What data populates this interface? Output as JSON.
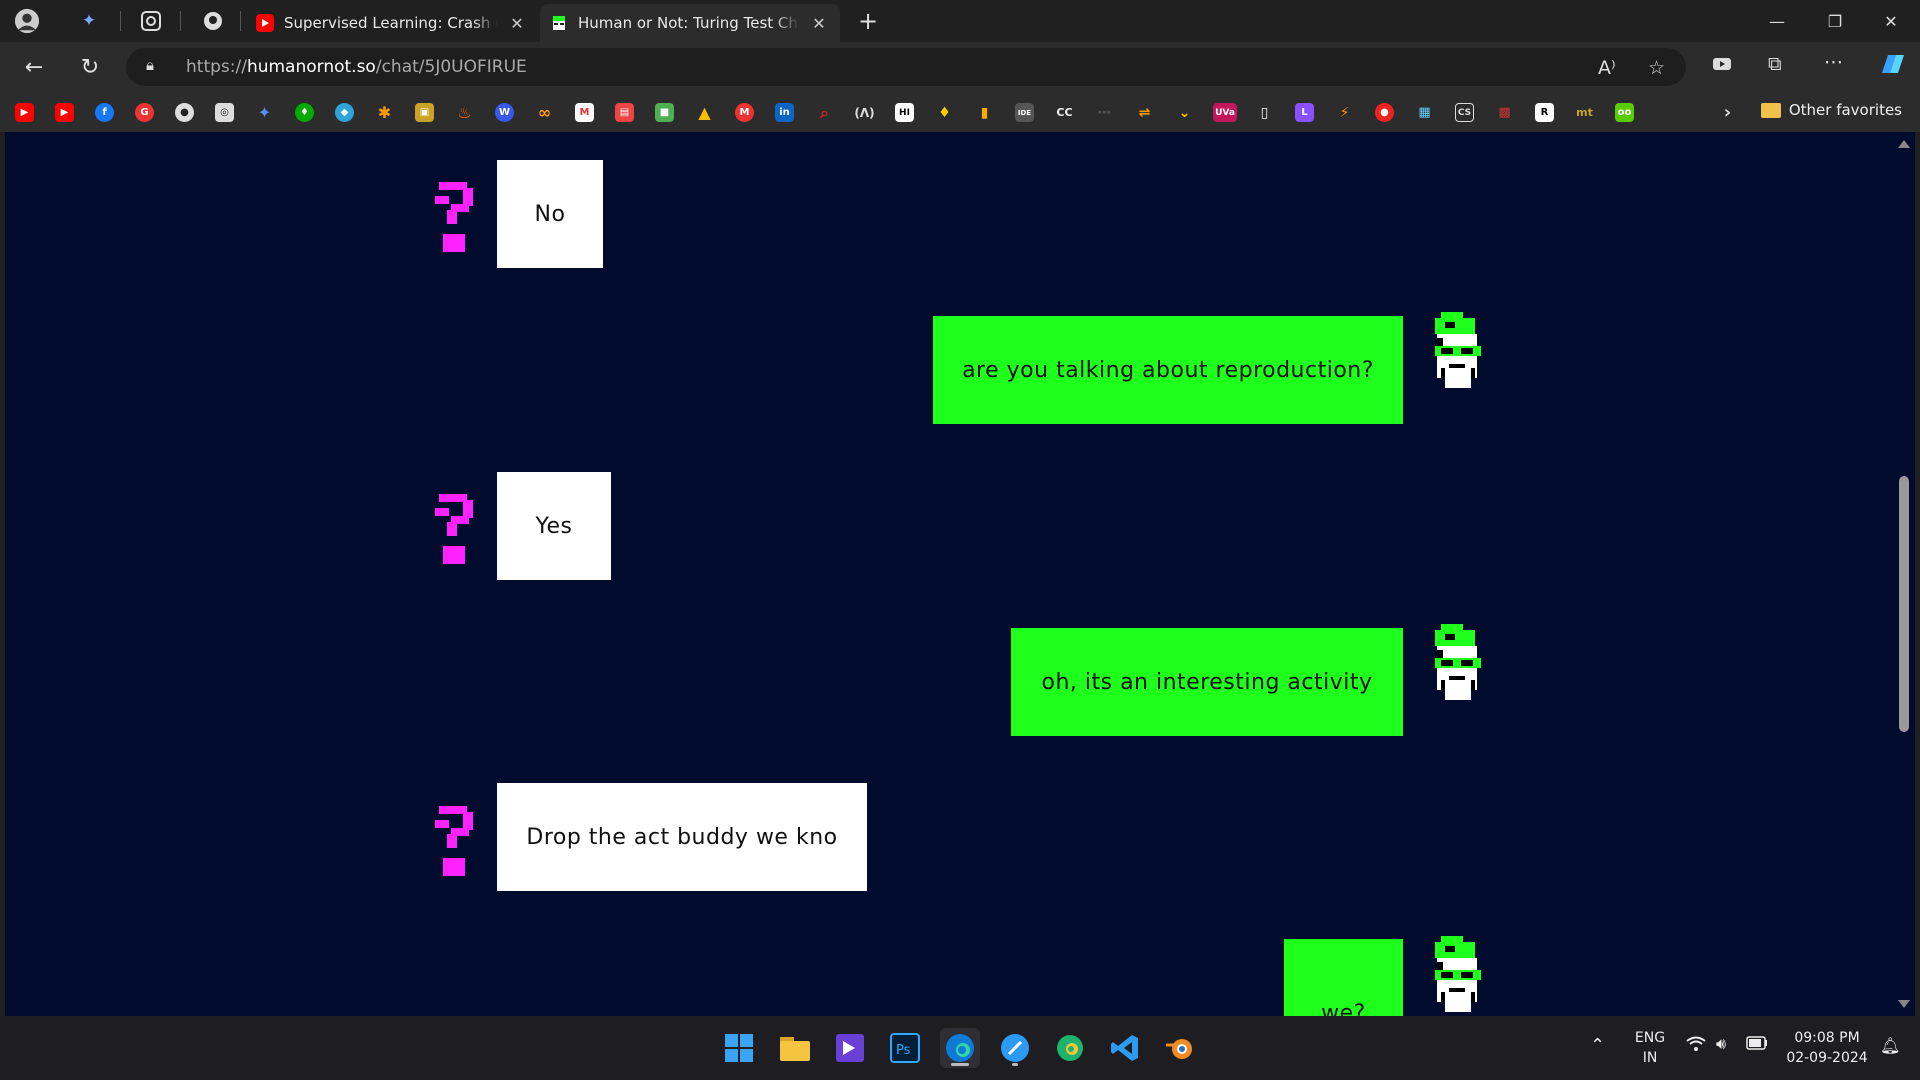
{
  "browser": {
    "tabs": [
      {
        "title": "Supervised Learning: Crash Cours",
        "favicon": "youtube-icon"
      },
      {
        "title": "Human or Not: Turing Test Chat S",
        "favicon": "human-or-not-icon",
        "active": true
      }
    ],
    "new_tab_label": "+",
    "url_prefix": "https://",
    "url_domain": "humanornot.so",
    "url_path": "/chat/5J0UOFIRUE",
    "other_favorites_label": "Other favorites"
  },
  "chat": {
    "messages": [
      {
        "sender": "them",
        "text": "No"
      },
      {
        "sender": "me",
        "text": "are you talking about reproduction?"
      },
      {
        "sender": "them",
        "text": "Yes"
      },
      {
        "sender": "me",
        "text": "oh, its an interesting activity"
      },
      {
        "sender": "them",
        "text": "Drop the act buddy we kno"
      },
      {
        "sender": "me",
        "text": "we?"
      }
    ]
  },
  "colors": {
    "page_bg": "#010b2e",
    "my_bubble": "#1fff1c",
    "their_bubble": "#ffffff",
    "question_avatar": "#ff22ff"
  },
  "taskbar": {
    "lang_line1": "ENG",
    "lang_line2": "IN",
    "time": "09:08 PM",
    "date": "02-09-2024"
  }
}
